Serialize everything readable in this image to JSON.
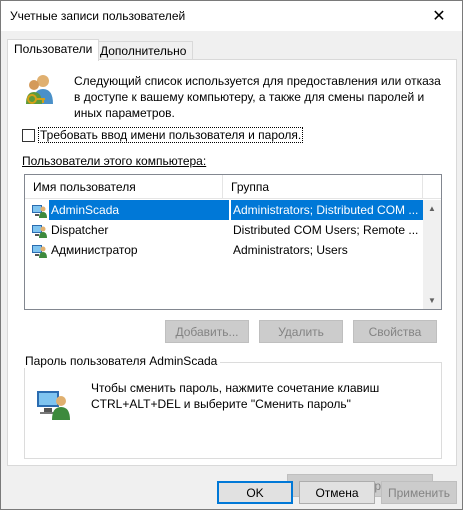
{
  "window": {
    "title": "Учетные записи пользователей"
  },
  "tabs": [
    {
      "label": "Пользователи",
      "active": true
    },
    {
      "label": "Дополнительно",
      "active": false
    }
  ],
  "intro": {
    "icon": "users-keys-icon",
    "text": "Следующий список используется для предоставления или отказа в доступе к вашему компьютеру, а также для смены паролей и иных параметров."
  },
  "require_login": {
    "label": "Требовать ввод имени пользователя и пароля.",
    "checked": false
  },
  "users_list": {
    "label": "Пользователи этого компьютера:",
    "columns": [
      "Имя пользователя",
      "Группа"
    ],
    "rows": [
      {
        "name": "AdminScada",
        "group": "Administrators; Distributed COM ...",
        "selected": true
      },
      {
        "name": "Dispatcher",
        "group": "Distributed COM Users; Remote ...",
        "selected": false
      },
      {
        "name": "Администратор",
        "group": "Administrators; Users",
        "selected": false
      }
    ]
  },
  "list_buttons": {
    "add": "Добавить...",
    "remove": "Удалить",
    "properties": "Свойства"
  },
  "password_group": {
    "title": "Пароль пользователя AdminScada",
    "text": "Чтобы сменить пароль, нажмите сочетание клавиш CTRL+ALT+DEL и выберите \"Сменить пароль\"",
    "change_button": "Сменить пароль..."
  },
  "dialog_buttons": {
    "ok": "OK",
    "cancel": "Отмена",
    "apply": "Применить"
  },
  "colors": {
    "selection": "#0078d7",
    "window_bg": "#f0f0f0",
    "disabled_text": "#838383"
  }
}
